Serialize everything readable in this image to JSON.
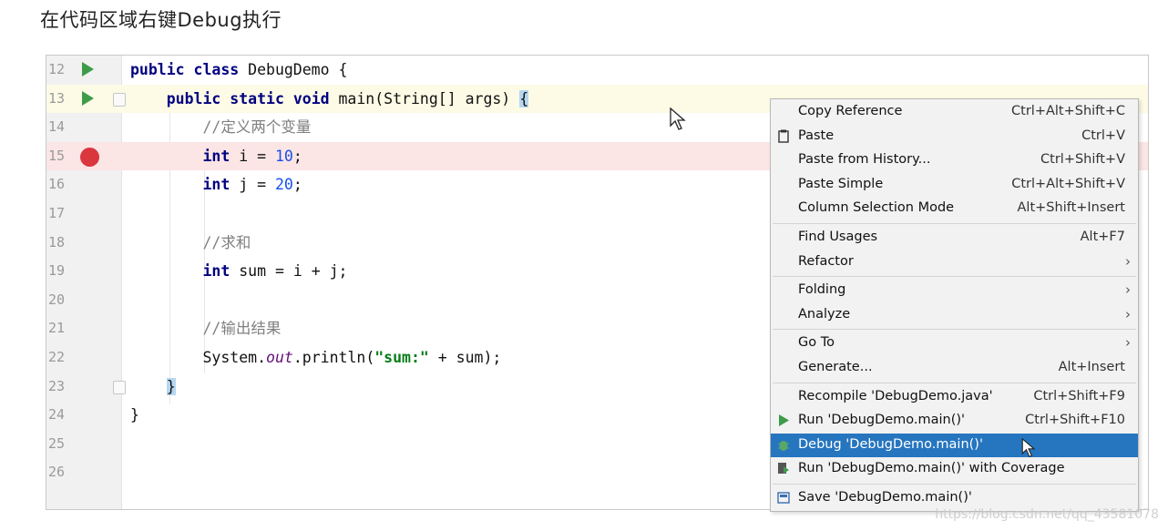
{
  "caption": "在代码区域右键Debug执行",
  "editor": {
    "lines": [
      {
        "num": "12",
        "parts": [
          [
            "kw",
            "public class "
          ],
          [
            "",
            "DebugDemo {"
          ]
        ]
      },
      {
        "num": "13",
        "parts": [
          [
            "",
            "    "
          ],
          [
            "kw",
            "public static void "
          ],
          [
            "",
            "main(String[] args) "
          ],
          [
            "brace-hl",
            "{"
          ]
        ]
      },
      {
        "num": "14",
        "parts": [
          [
            "",
            "        "
          ],
          [
            "cm",
            "//定义两个变量"
          ]
        ]
      },
      {
        "num": "15",
        "parts": [
          [
            "",
            "        "
          ],
          [
            "kw",
            "int "
          ],
          [
            "",
            "i = "
          ],
          [
            "num",
            "10"
          ],
          [
            "",
            ";"
          ]
        ]
      },
      {
        "num": "16",
        "parts": [
          [
            "",
            "        "
          ],
          [
            "kw",
            "int "
          ],
          [
            "",
            "j = "
          ],
          [
            "num",
            "20"
          ],
          [
            "",
            ";"
          ]
        ]
      },
      {
        "num": "17",
        "parts": []
      },
      {
        "num": "18",
        "parts": [
          [
            "",
            "        "
          ],
          [
            "cm",
            "//求和"
          ]
        ]
      },
      {
        "num": "19",
        "parts": [
          [
            "",
            "        "
          ],
          [
            "kw",
            "int "
          ],
          [
            "",
            "sum = i + j;"
          ]
        ]
      },
      {
        "num": "20",
        "parts": []
      },
      {
        "num": "21",
        "parts": [
          [
            "",
            "        "
          ],
          [
            "cm",
            "//输出结果"
          ]
        ]
      },
      {
        "num": "22",
        "parts": [
          [
            "",
            "        "
          ],
          [
            "",
            "System."
          ],
          [
            "fld",
            "out"
          ],
          [
            "",
            ".println("
          ],
          [
            "str",
            "\"sum:\""
          ],
          [
            "",
            " + sum);"
          ]
        ]
      },
      {
        "num": "23",
        "parts": [
          [
            "",
            "    "
          ],
          [
            "brace-hl",
            "}"
          ]
        ]
      },
      {
        "num": "24",
        "parts": [
          [
            "",
            "}"
          ]
        ]
      },
      {
        "num": "25",
        "parts": []
      },
      {
        "num": "26",
        "parts": []
      }
    ]
  },
  "context_menu": {
    "items": [
      {
        "label": "Copy Reference",
        "shortcut": "Ctrl+Alt+Shift+C"
      },
      {
        "label": "Paste",
        "shortcut": "Ctrl+V",
        "icon": "clipboard-icon"
      },
      {
        "label": "Paste from History...",
        "shortcut": "Ctrl+Shift+V"
      },
      {
        "label": "Paste Simple",
        "shortcut": "Ctrl+Alt+Shift+V"
      },
      {
        "label": "Column Selection Mode",
        "shortcut": "Alt+Shift+Insert"
      },
      {
        "label": "Find Usages",
        "shortcut": "Alt+F7"
      },
      {
        "label": "Refactor",
        "submenu": true
      },
      {
        "label": "Folding",
        "submenu": true
      },
      {
        "label": "Analyze",
        "submenu": true
      },
      {
        "label": "Go To",
        "submenu": true
      },
      {
        "label": "Generate...",
        "shortcut": "Alt+Insert"
      },
      {
        "label": "Recompile 'DebugDemo.java'",
        "shortcut": "Ctrl+Shift+F9"
      },
      {
        "label": "Run 'DebugDemo.main()'",
        "shortcut": "Ctrl+Shift+F10",
        "icon": "run-icon"
      },
      {
        "label": "Debug 'DebugDemo.main()'",
        "selected": true,
        "icon": "debug-bug-icon"
      },
      {
        "label": "Run 'DebugDemo.main()' with Coverage",
        "icon": "coverage-icon"
      },
      {
        "label": "Save 'DebugDemo.main()'",
        "icon": "save-config-icon"
      }
    ],
    "submenu_arrow": "›"
  },
  "watermark": "https://blog.csdn.net/qq_43581078",
  "colors": {
    "selection": "#2675bf",
    "breakpoint": "#d9363e",
    "run_green": "#3e9b4a",
    "keyword": "#000080"
  }
}
